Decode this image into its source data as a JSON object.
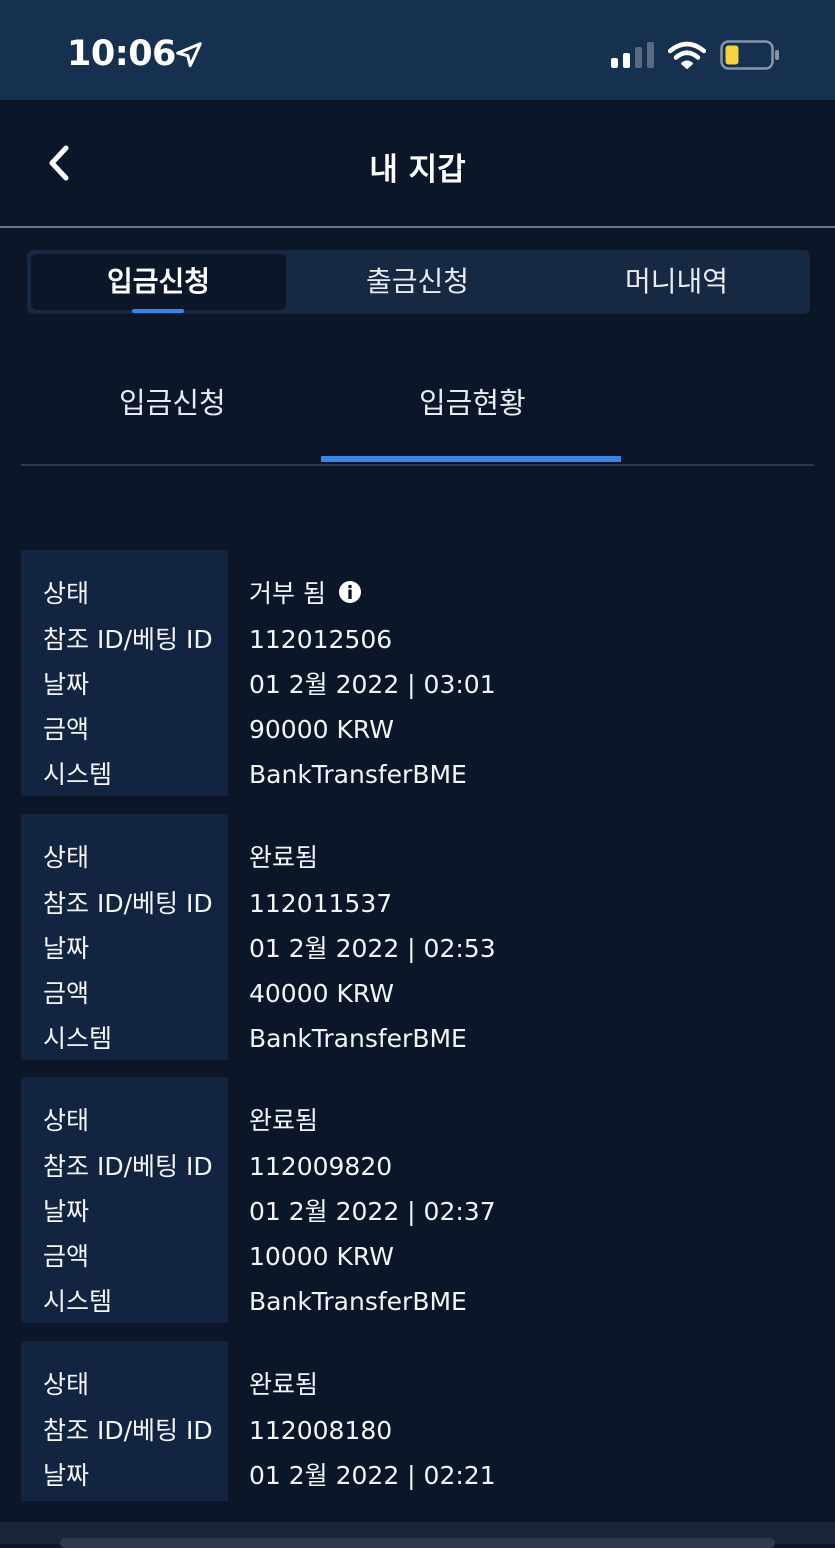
{
  "status_bar": {
    "time": "10:06"
  },
  "header": {
    "title": "내 지갑"
  },
  "segment_tabs": [
    {
      "label": "입금신청"
    },
    {
      "label": "출금신청"
    },
    {
      "label": "머니내역"
    }
  ],
  "sub_tabs": [
    {
      "label": "입금신청"
    },
    {
      "label": "입금현황"
    }
  ],
  "field_labels": {
    "status": "상태",
    "ref_id": "참조 ID/베팅 ID",
    "date": "날짜",
    "amount": "금액",
    "system": "시스템"
  },
  "records": [
    {
      "status": "거부 됨",
      "ref_id": "112012506",
      "date": "01 2월 2022 | 03:01",
      "amount": "90000 KRW",
      "system": "BankTransferBME"
    },
    {
      "status": "완료됨",
      "ref_id": "112011537",
      "date": "01 2월 2022 | 02:53",
      "amount": "40000 KRW",
      "system": "BankTransferBME"
    },
    {
      "status": "완료됨",
      "ref_id": "112009820",
      "date": "01 2월 2022 | 02:37",
      "amount": "10000 KRW",
      "system": "BankTransferBME"
    },
    {
      "status": "완료됨",
      "ref_id": "112008180",
      "date": "01 2월 2022 | 02:21"
    }
  ],
  "colors": {
    "background": "#0b1628",
    "status_bar": "#16304f",
    "label_column": "#132440",
    "accent": "#3a86e6",
    "battery_level": "#f5d33c"
  }
}
